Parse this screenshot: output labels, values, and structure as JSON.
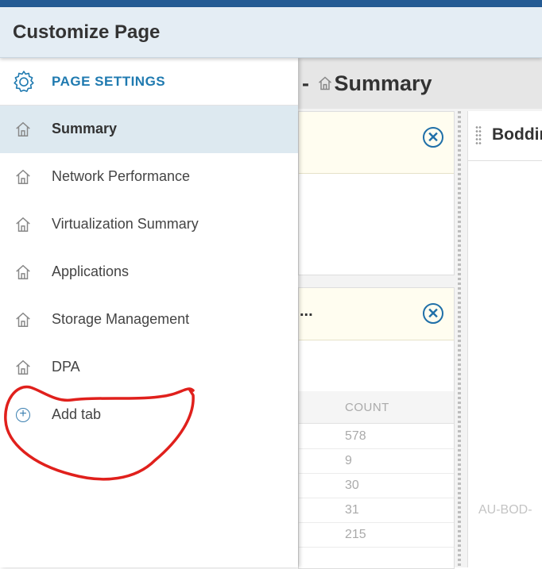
{
  "header": {
    "title": "Customize Page"
  },
  "page": {
    "title_prefix": "-",
    "title": "Summary"
  },
  "panel": {
    "settings_label": "PAGE SETTINGS",
    "tabs": [
      {
        "label": "Summary",
        "active": true,
        "icon": "home-icon"
      },
      {
        "label": "Network Performance",
        "active": false,
        "icon": "home-icon"
      },
      {
        "label": "Virtualization Summary",
        "active": false,
        "icon": "home-icon"
      },
      {
        "label": "Applications",
        "active": false,
        "icon": "home-icon"
      },
      {
        "label": "Storage Management",
        "active": false,
        "icon": "home-icon"
      },
      {
        "label": "DPA",
        "active": false,
        "icon": "home-icon"
      }
    ],
    "add_tab_label": "Add tab"
  },
  "widgets": {
    "second_title_ellipsis": "...",
    "count_header": "COUNT",
    "counts": [
      "578",
      "9",
      "30",
      "31",
      "215"
    ]
  },
  "right_column": {
    "widget_title": "Boddir",
    "node_text": "AU-BOD-"
  },
  "colors": {
    "accent": "#1f7ab0",
    "active_row": "#dde9f0",
    "annotation": "#e0201c"
  }
}
